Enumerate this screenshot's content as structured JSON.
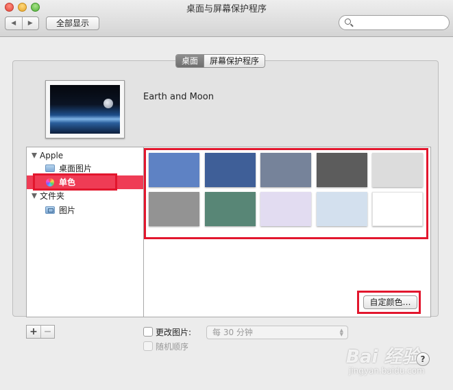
{
  "window": {
    "title": "桌面与屏幕保护程序"
  },
  "toolbar": {
    "back": "◀",
    "forward": "▶",
    "show_all": "全部显示",
    "search_placeholder": ""
  },
  "tabs": [
    {
      "label": "桌面",
      "active": true
    },
    {
      "label": "屏幕保护程序",
      "active": false
    }
  ],
  "preview": {
    "name": "Earth and Moon"
  },
  "source_list": {
    "items": [
      {
        "label": "Apple",
        "kind": "group"
      },
      {
        "label": "桌面图片",
        "kind": "folder"
      },
      {
        "label": "单色",
        "kind": "colors",
        "selected": true
      },
      {
        "label": "文件夹",
        "kind": "group"
      },
      {
        "label": "图片",
        "kind": "pictures-folder"
      }
    ]
  },
  "swatches": [
    "#5e82c4",
    "#3f5f98",
    "#76839a",
    "#5c5c5c",
    "#dcdcdc",
    "#939393",
    "#588676",
    "#e2dcf1",
    "#d3e0ee",
    "#ffffff"
  ],
  "buttons": {
    "custom_color": "自定颜色…",
    "add": "+",
    "remove": "−"
  },
  "options": {
    "change_picture": {
      "label": "更改图片:",
      "checked": false
    },
    "interval": {
      "value": "每 30 分钟",
      "enabled": false
    },
    "random_order": {
      "label": "随机顺序",
      "checked": false,
      "enabled": false
    }
  },
  "help": "?",
  "watermark": {
    "logo": "Bai 经验",
    "url": "jingyan.baidu.com"
  },
  "highlight_color": "#e2162d",
  "selection_color": "#ef3c55"
}
